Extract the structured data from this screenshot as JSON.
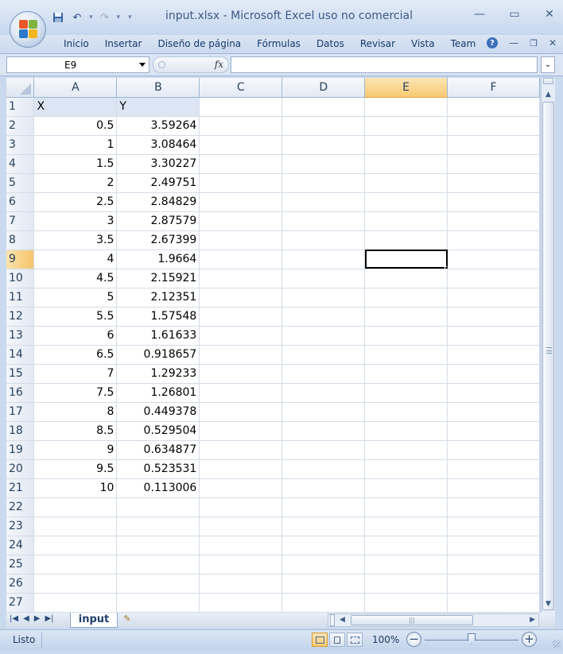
{
  "window": {
    "title": "input.xlsx - Microsoft Excel uso no comercial"
  },
  "ribbon": {
    "tabs": [
      "Inicio",
      "Insertar",
      "Diseño de página",
      "Fórmulas",
      "Datos",
      "Revisar",
      "Vista",
      "Team"
    ]
  },
  "formula_bar": {
    "name_box": "E9",
    "fx_label": "fx",
    "formula": ""
  },
  "grid": {
    "columns": [
      "A",
      "B",
      "C",
      "D",
      "E",
      "F"
    ],
    "active_column": "E",
    "active_row": 9,
    "header": {
      "A": "X",
      "B": "Y"
    },
    "rows": [
      {
        "row": 2,
        "A": "0.5",
        "B": "3.59264"
      },
      {
        "row": 3,
        "A": "1",
        "B": "3.08464"
      },
      {
        "row": 4,
        "A": "1.5",
        "B": "3.30227"
      },
      {
        "row": 5,
        "A": "2",
        "B": "2.49751"
      },
      {
        "row": 6,
        "A": "2.5",
        "B": "2.84829"
      },
      {
        "row": 7,
        "A": "3",
        "B": "2.87579"
      },
      {
        "row": 8,
        "A": "3.5",
        "B": "2.67399"
      },
      {
        "row": 9,
        "A": "4",
        "B": "1.9664"
      },
      {
        "row": 10,
        "A": "4.5",
        "B": "2.15921"
      },
      {
        "row": 11,
        "A": "5",
        "B": "2.12351"
      },
      {
        "row": 12,
        "A": "5.5",
        "B": "1.57548"
      },
      {
        "row": 13,
        "A": "6",
        "B": "1.61633"
      },
      {
        "row": 14,
        "A": "6.5",
        "B": "0.918657"
      },
      {
        "row": 15,
        "A": "7",
        "B": "1.29233"
      },
      {
        "row": 16,
        "A": "7.5",
        "B": "1.26801"
      },
      {
        "row": 17,
        "A": "8",
        "B": "0.449378"
      },
      {
        "row": 18,
        "A": "8.5",
        "B": "0.529504"
      },
      {
        "row": 19,
        "A": "9",
        "B": "0.634877"
      },
      {
        "row": 20,
        "A": "9.5",
        "B": "0.523531"
      },
      {
        "row": 21,
        "A": "10",
        "B": "0.113006"
      }
    ],
    "row_numbers": [
      "1",
      "2",
      "3",
      "4",
      "5",
      "6",
      "7",
      "8",
      "9",
      "10",
      "11",
      "12",
      "13",
      "14",
      "15",
      "16",
      "17",
      "18",
      "19",
      "20",
      "21",
      "22",
      "23",
      "24",
      "25",
      "26",
      "27"
    ]
  },
  "sheets": {
    "active": "input"
  },
  "status_bar": {
    "status": "Listo",
    "zoom": "100%"
  },
  "icons": {
    "save": "save-icon",
    "undo": "undo-icon",
    "redo": "redo-icon",
    "help": "help-icon",
    "new_sheet": "insert-sheet-icon"
  },
  "colors": {
    "active_header": "#f7c971",
    "header_row_fill": "#dbe5f3",
    "title_text": "#3e5a85"
  }
}
